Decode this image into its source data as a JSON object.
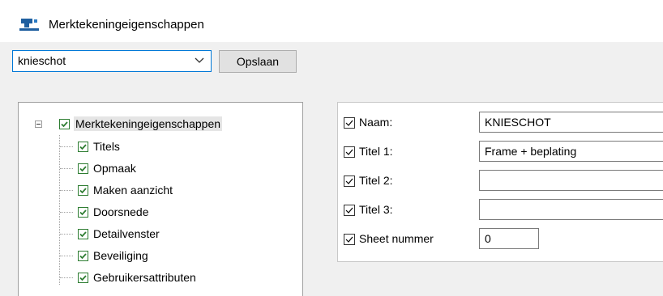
{
  "window": {
    "title": "Merktekeningeigenschappen"
  },
  "toolbar": {
    "preset_value": "knieschot",
    "save_label": "Opslaan"
  },
  "tree": {
    "root_label": "Merktekeningeigenschappen",
    "items": [
      {
        "label": "Titels"
      },
      {
        "label": "Opmaak"
      },
      {
        "label": "Maken aanzicht"
      },
      {
        "label": "Doorsnede"
      },
      {
        "label": "Detailvenster"
      },
      {
        "label": "Beveiliging"
      },
      {
        "label": "Gebruikersattributen"
      }
    ]
  },
  "properties": [
    {
      "label": "Naam:",
      "value": "KNIESCHOT",
      "checked": true
    },
    {
      "label": "Titel 1:",
      "value": "Frame + beplating",
      "checked": true
    },
    {
      "label": "Titel 2:",
      "value": "",
      "checked": true
    },
    {
      "label": "Titel 3:",
      "value": "",
      "checked": true
    },
    {
      "label": "Sheet nummer",
      "value": "0",
      "checked": true
    }
  ],
  "colors": {
    "accent": "#0078d7",
    "checkbox_green": "#2e7d32"
  }
}
